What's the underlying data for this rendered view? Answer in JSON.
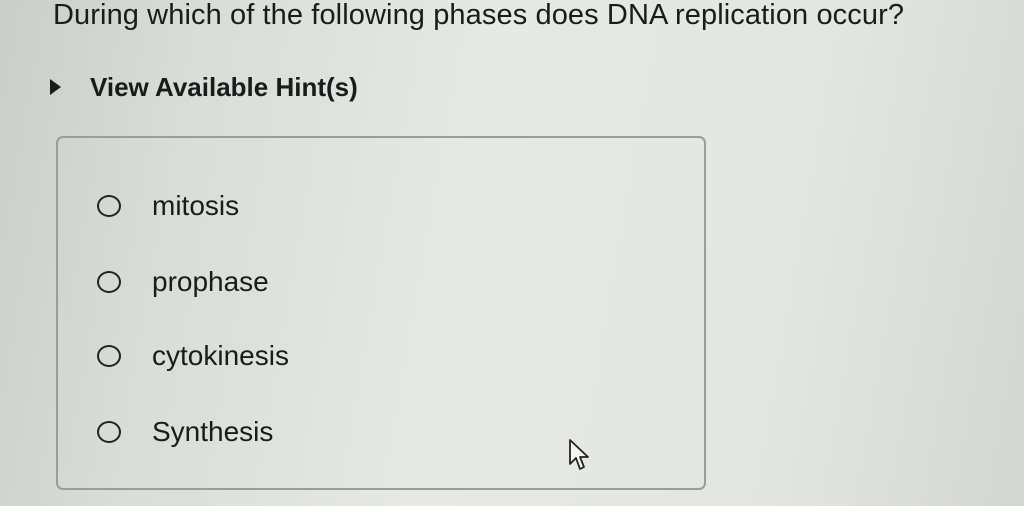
{
  "question": {
    "text": "During which of the following phases does DNA replication occur?"
  },
  "hint": {
    "label": "View Available Hint(s)"
  },
  "options": [
    {
      "label": "mitosis"
    },
    {
      "label": "prophase"
    },
    {
      "label": "cytokinesis"
    },
    {
      "label": "Synthesis"
    }
  ]
}
